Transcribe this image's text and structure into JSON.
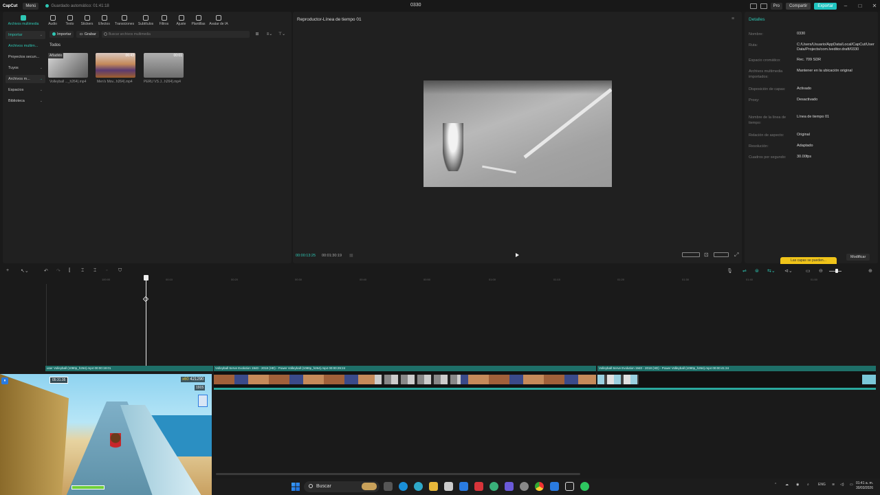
{
  "titlebar": {
    "logo": "CapCut",
    "menu": "Menú",
    "autosave": "Guardado automático: 01:41:18",
    "title": "0330",
    "pro": "Pro",
    "share": "Compartir",
    "export": "Exportar"
  },
  "toolbar": {
    "items": [
      "Archivos multimedia",
      "Audio",
      "Texto",
      "Stickers",
      "Efectos",
      "Transiciones",
      "Subtítulos",
      "Filtros",
      "Ajuste",
      "Plantillas",
      "Avatar de IA"
    ]
  },
  "sidenav": {
    "items": [
      "Importar",
      "Archivos multim...",
      "Proyectos secun...",
      "Tuyos",
      "Archivos m...",
      "Espacios",
      "Biblioteca"
    ]
  },
  "media": {
    "import": "Importar",
    "record": "Grabar",
    "search_placeholder": "Buscar archivos multimedia",
    "section": "Todos",
    "files": [
      {
        "name": "Volleyball ..._h264).mp4",
        "badge": "Añadido",
        "duration": ""
      },
      {
        "name": "Men's Mov...h264).mp4",
        "badge": "",
        "duration": "06:43"
      },
      {
        "name": "PERU VS J...h264).mp4",
        "badge": "",
        "duration": "00:01"
      }
    ]
  },
  "player": {
    "title": "Reproductor-Línea de tiempo 01",
    "current": "00:00:13:25",
    "total": "00:01:30:19"
  },
  "details": {
    "header": "Detalles",
    "rows": [
      {
        "k": "Nombre:",
        "v": "0330"
      },
      {
        "k": "Ruta:",
        "v": "C:/Users/Usuario/AppData/Local/CapCut/User Data/Projects/com.lveditor.draft/0330"
      },
      {
        "k": "Espacio cromático:",
        "v": "Rec. 709 SDR"
      },
      {
        "k": "Archivos multimedia importados:",
        "v": "Mantener en la ubicación original"
      },
      {
        "k": "Disposición de capas:",
        "v": "Activado"
      },
      {
        "k": "Proxy:",
        "v": "Desactivado"
      },
      {
        "k": "Nombre de la línea de tiempo:",
        "v": "Línea de tiempo 01"
      },
      {
        "k": "Relación de aspecto:",
        "v": "Original"
      },
      {
        "k": "Resolución:",
        "v": "Adaptado"
      },
      {
        "k": "Cuadros por segundo:",
        "v": "30.00fps"
      }
    ],
    "tip": "Las capas se pueden...",
    "modify": "Modificar"
  },
  "timeline": {
    "ticks": [
      "100:00",
      "00:10",
      "00:20",
      "00:30",
      "00:40",
      "00:50",
      "01:00",
      "01:10",
      "01:20",
      "01:30",
      "01:40",
      "01:50"
    ],
    "clips": [
      {
        "label": "user Volleyball (1080p_h264).mp4  00:00:19:01"
      },
      {
        "label": "Volleyball Serve Evolution 1940 - 2018 (HD) - Power Volleyball (1080p_h264).mp4  00:00:29:24"
      },
      {
        "label": "Volleyball Serve Evolution 1940 - 2018 (HD) - Power Volleyball (1080p_h264).mp4  00:00:41:24"
      }
    ]
  },
  "game": {
    "timer": "05:31.05",
    "multiplier": "x60",
    "score": "421290",
    "coins": "1915"
  },
  "taskbar": {
    "search": "Buscar",
    "lang": "ENG",
    "time": "01:41 a. m.",
    "date": "30/03/2026"
  },
  "colors": {
    "accent": "#2ec7b4",
    "export": "#1fc4c0",
    "tip": "#f0c419"
  }
}
